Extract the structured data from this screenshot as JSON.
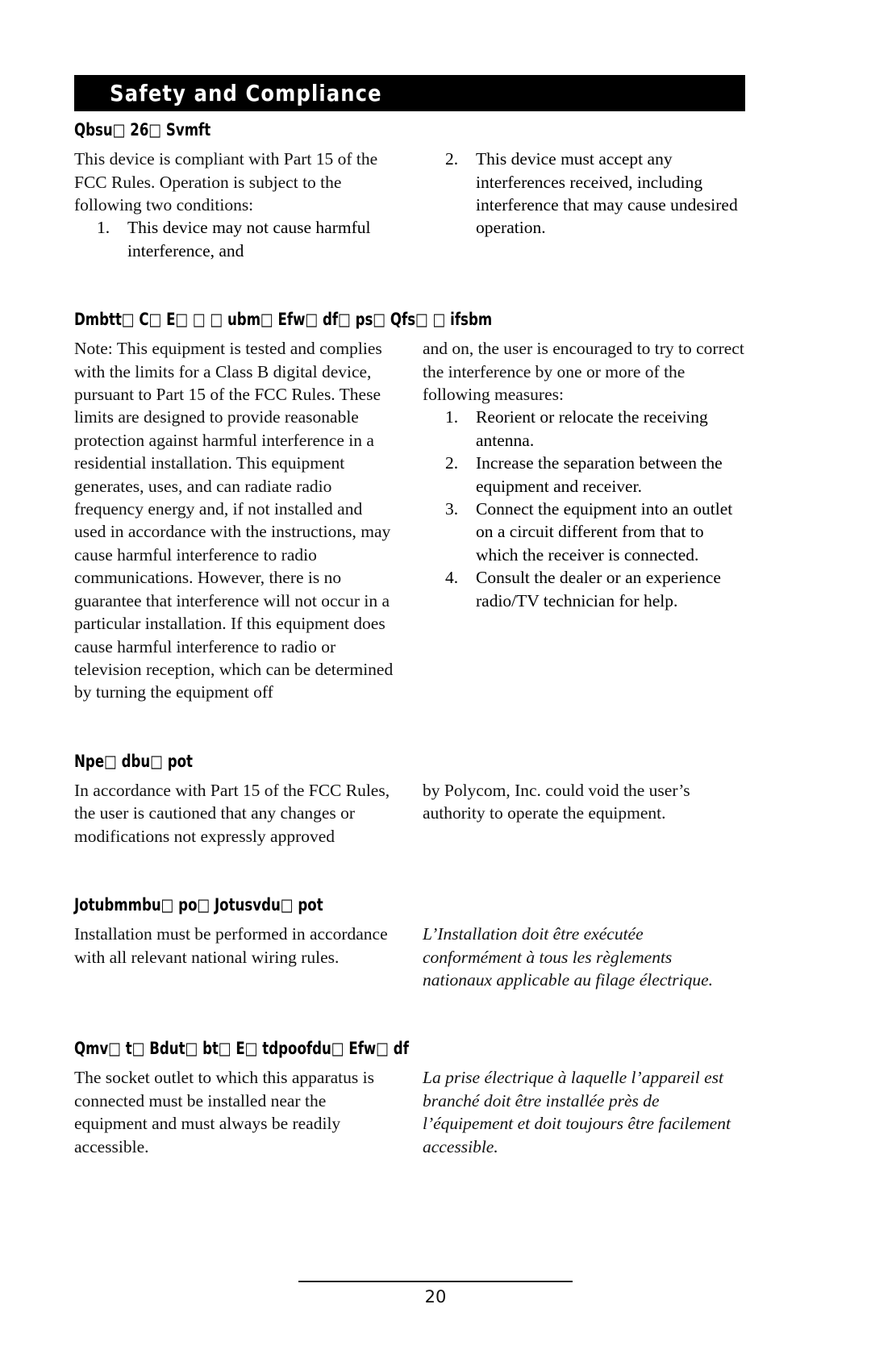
{
  "header": {
    "title": "Safety and Compliance"
  },
  "sections": [
    {
      "heading": "Qbsu□ 26□ Svmft",
      "left": {
        "paragraphs": [
          "This device is compliant with Part 15 of the FCC Rules.  Operation is subject to the following two conditions:"
        ],
        "list": [
          {
            "num": "1.",
            "text": "This device may not cause harmful interference, and"
          }
        ]
      },
      "right": {
        "paragraphs": [],
        "list": [
          {
            "num": "2.",
            "text": "This device must accept any interferences received, including interference that may cause undesired operation."
          }
        ]
      }
    },
    {
      "heading": "Dmbtt□ C□ E□ □ □ ubm□ Efw□ df□ ps□ Qfs□ □ ifsbm",
      "left": {
        "paragraphs": [
          "Note:  This equipment is tested and complies with the limits for a Class B digital device, pursuant to Part 15 of the FCC Rules.  These limits are designed to provide reasonable protection against harmful interference in a residential installation.  This equipment generates, uses, and can radiate radio frequency energy and, if not installed and used in accordance with the instructions, may cause harmful interference to radio communications.  However, there is no guarantee that interference will not occur in a particular installation.  If this equipment does cause harmful interference to radio or television reception, which can be determined by turning the equipment off"
        ],
        "list": []
      },
      "right": {
        "paragraphs": [
          "and on, the user is encouraged to try to correct the interference by one or more of the following measures:"
        ],
        "list": [
          {
            "num": "1.",
            "text": "Reorient or relocate the receiving antenna."
          },
          {
            "num": "2.",
            "text": "Increase the separation between the equipment and receiver."
          },
          {
            "num": "3.",
            "text": "Connect the equipment into an outlet on a circuit different from that to which the receiver is connected."
          },
          {
            "num": "4.",
            "text": "Consult the dealer or an experience radio/TV technician for help."
          }
        ]
      }
    },
    {
      "heading": "Npe□   dbu□ pot",
      "left": {
        "paragraphs": [
          "In accordance with Part 15 of the FCC Rules, the user is cautioned that any changes or modifications not expressly approved"
        ],
        "list": []
      },
      "right": {
        "paragraphs": [
          "by Polycom, Inc. could void the user’s authority to operate the equipment."
        ],
        "list": []
      }
    },
    {
      "heading": "Jotubmmbu□ po□ Jotusvdu□ pot",
      "left": {
        "paragraphs": [
          "Installation must be performed in accordance with all relevant national wiring rules."
        ],
        "list": []
      },
      "right": {
        "paragraphs_fr": [
          "L’Installation doit être exécutée conformément à tous les règlements nationaux applicable au filage électrique."
        ],
        "list": []
      }
    },
    {
      "heading": "Qmv□ t□ Bdut□ bt□ E□ tdpoofdu□ Efw□ df",
      "left": {
        "paragraphs": [
          "The socket outlet to which this apparatus is connected must be installed near the equipment and must always be readily accessible."
        ],
        "list": []
      },
      "right": {
        "paragraphs_fr": [
          "La prise électrique à laquelle l’appareil est branché doit être installée près de l’équipement et doit toujours être facilement accessible."
        ],
        "list": []
      }
    }
  ],
  "footer": {
    "page_number": "20"
  }
}
